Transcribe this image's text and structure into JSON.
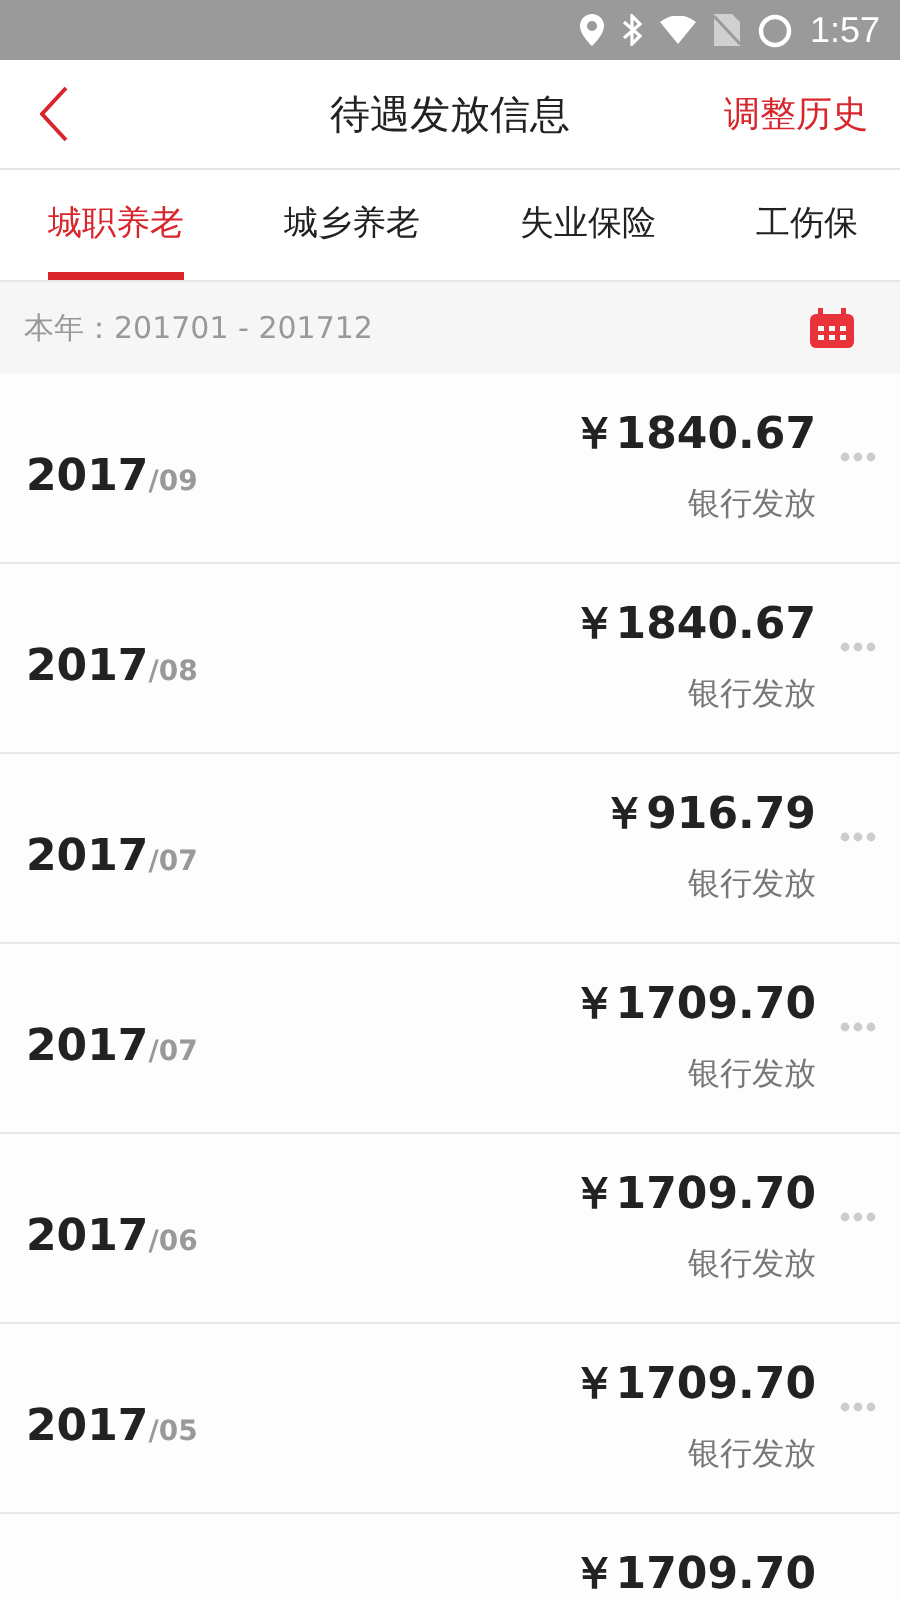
{
  "status_bar": {
    "time": "1:57"
  },
  "header": {
    "title": "待遇发放信息",
    "action": "调整历史"
  },
  "tabs": [
    {
      "label": "城职养老",
      "selected": true
    },
    {
      "label": "城乡养老",
      "selected": false
    },
    {
      "label": "失业保险",
      "selected": false
    },
    {
      "label": "工伤保",
      "selected": false
    }
  ],
  "period": {
    "label": "本年：201701 - 201712"
  },
  "rows": [
    {
      "year": "2017",
      "month": "/09",
      "amount": "￥1840.67",
      "method": "银行发放"
    },
    {
      "year": "2017",
      "month": "/08",
      "amount": "￥1840.67",
      "method": "银行发放"
    },
    {
      "year": "2017",
      "month": "/07",
      "amount": "￥916.79",
      "method": "银行发放"
    },
    {
      "year": "2017",
      "month": "/07",
      "amount": "￥1709.70",
      "method": "银行发放"
    },
    {
      "year": "2017",
      "month": "/06",
      "amount": "￥1709.70",
      "method": "银行发放"
    },
    {
      "year": "2017",
      "month": "/05",
      "amount": "￥1709.70",
      "method": "银行发放"
    },
    {
      "amount": "￥1709.70"
    }
  ]
}
